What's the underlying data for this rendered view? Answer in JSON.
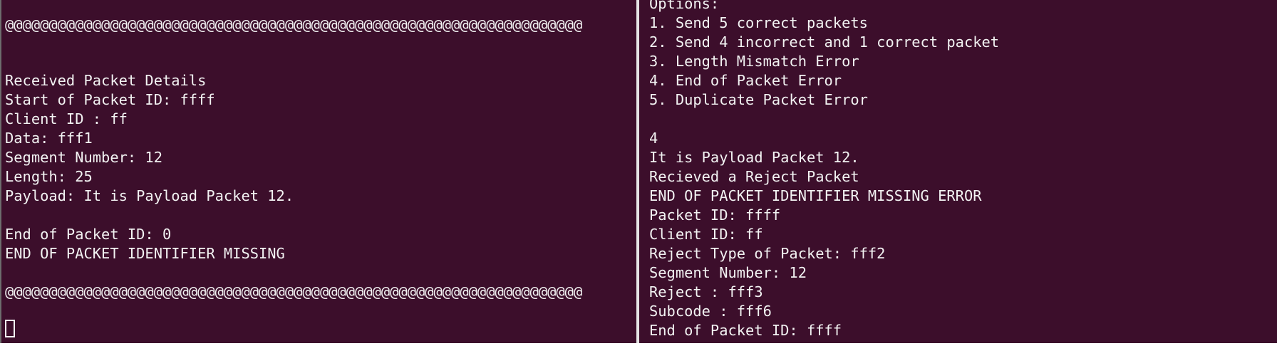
{
  "left_terminal": {
    "separator_top": "@@@@@@@@@@@@@@@@@@@@@@@@@@@@@@@@@@@@@@@@@@@@@@@@@@@@@@@@@@@@@@@@@@",
    "heading": "Received Packet Details",
    "start_id": "Start of Packet ID: ffff",
    "client_id": "Client ID : ff",
    "data": "Data: fff1",
    "segment": "Segment Number: 12",
    "length": "Length: 25",
    "payload": "Payload: It is Payload Packet 12.",
    "end_id": "End of Packet ID: 0",
    "end_missing": "END OF PACKET IDENTIFIER MISSING",
    "separator_bottom": "@@@@@@@@@@@@@@@@@@@@@@@@@@@@@@@@@@@@@@@@@@@@@@@@@@@@@@@@@@@@@@@@@@"
  },
  "right_terminal": {
    "options_title": "Options:",
    "option_1": "1. Send 5 correct packets",
    "option_2": "2. Send 4 incorrect and 1 correct packet",
    "option_3": "3. Length Mismatch Error",
    "option_4": "4. End of Packet Error",
    "option_5": "5. Duplicate Packet Error",
    "choice": "4",
    "payload_line": "It is Payload Packet 12.",
    "reject_received": "Recieved a Reject Packet",
    "error": "END OF PACKET IDENTIFIER MISSING ERROR",
    "packet_id": "Packet ID: ffff",
    "client_id": "Client ID: ff",
    "reject_type": "Reject Type of Packet: fff2",
    "segment": "Segment Number: 12",
    "reject": "Reject : fff3",
    "subcode": "Subcode : fff6",
    "end_id": "End of Packet ID: ffff"
  }
}
